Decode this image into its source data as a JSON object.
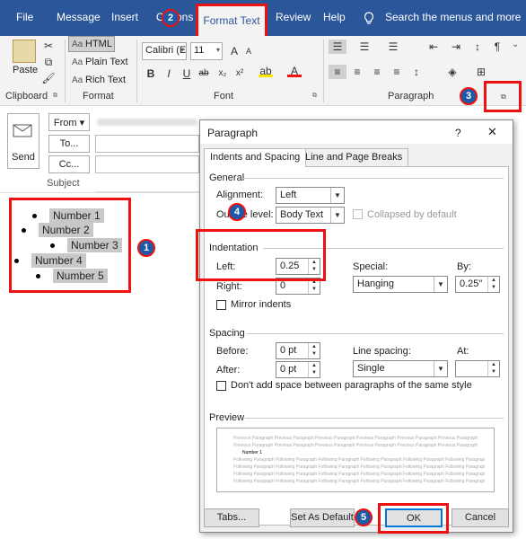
{
  "tabs": [
    "File",
    "Message",
    "Insert",
    "Options",
    "Format Text",
    "Review",
    "Help"
  ],
  "search_menu": "Search the menus and more",
  "ribbon": {
    "paste": "Paste",
    "format_html": "HTML",
    "format_plain": "Plain Text",
    "format_rich": "Rich Text",
    "font_name": "Calibri (E",
    "font_size": "11",
    "groups": {
      "clipboard": "Clipboard",
      "format": "Format",
      "font": "Font",
      "paragraph": "Paragraph"
    }
  },
  "compose": {
    "send": "Send",
    "from": "From",
    "to": "To...",
    "cc": "Cc...",
    "subject": "Subject"
  },
  "list": [
    "Number 1",
    "Number 2",
    "Number 3",
    "Number 4",
    "Number 5"
  ],
  "steps": [
    "1",
    "2",
    "3",
    "4",
    "5"
  ],
  "dialog": {
    "title": "Paragraph",
    "help": "?",
    "close": "✕",
    "tab_indents": "Indents and Spacing",
    "tab_breaks": "Line and Page Breaks",
    "general": "General",
    "alignment_label": "Alignment:",
    "alignment_value": "Left",
    "outline_label": "Outline level:",
    "outline_value": "Body Text",
    "collapsed": "Collapsed by default",
    "indentation": "Indentation",
    "left_label": "Left:",
    "left_value": "0.25",
    "right_label": "Right:",
    "right_value": "0",
    "special_label": "Special:",
    "special_value": "Hanging",
    "by_label": "By:",
    "by_value": "0.25\"",
    "mirror": "Mirror indents",
    "spacing": "Spacing",
    "before_label": "Before:",
    "before_value": "0 pt",
    "after_label": "After:",
    "after_value": "0 pt",
    "line_spacing_label": "Line spacing:",
    "line_spacing_value": "Single",
    "at_label": "At:",
    "dont_add": "Don't add space between paragraphs of the same style",
    "preview": "Preview",
    "preview_prev": "Previous Paragraph Previous Paragraph Previous Paragraph Previous Paragraph Previous Paragraph Previous Paragraph",
    "preview_item": "Number 1",
    "preview_follow": "Following Paragraph Following Paragraph Following Paragraph Following Paragraph Following Paragraph Following Paragraph",
    "tabs_btn": "Tabs...",
    "default_btn": "Set As Default",
    "ok_btn": "OK",
    "cancel_btn": "Cancel"
  },
  "colors": {
    "tabbar": "#2b579a",
    "highlight": "#ee1111",
    "step": "#1c5aa8"
  }
}
